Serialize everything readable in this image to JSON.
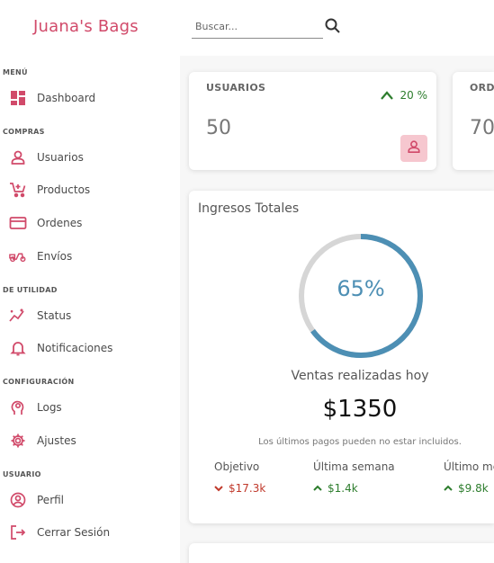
{
  "brand": {
    "name": "Juana's Bags",
    "accent": "#d14a6a"
  },
  "search": {
    "placeholder": "Buscar...",
    "icon": "search-icon"
  },
  "sidebar": {
    "sections": [
      {
        "title": "MENÚ",
        "items": [
          {
            "label": "Dashboard",
            "icon": "dashboard-icon"
          }
        ]
      },
      {
        "title": "COMPRAS",
        "items": [
          {
            "label": "Usuarios",
            "icon": "user-icon"
          },
          {
            "label": "Productos",
            "icon": "cart-icon"
          },
          {
            "label": "Ordenes",
            "icon": "credit-card-icon"
          },
          {
            "label": "Envíos",
            "icon": "delivery-scooter-icon"
          }
        ]
      },
      {
        "title": "DE UTILIDAD",
        "items": [
          {
            "label": "Status",
            "icon": "sparkle-chart-icon"
          },
          {
            "label": "Notificaciones",
            "icon": "bell-icon"
          }
        ]
      },
      {
        "title": "CONFIGURACIÓN",
        "items": [
          {
            "label": "Logs",
            "icon": "brain-head-icon"
          },
          {
            "label": "Ajustes",
            "icon": "gear-icon"
          }
        ]
      },
      {
        "title": "USUARIO",
        "items": [
          {
            "label": "Perfil",
            "icon": "profile-circle-icon"
          },
          {
            "label": "Cerrar Sesión",
            "icon": "logout-icon"
          }
        ]
      }
    ]
  },
  "stats": [
    {
      "title": "USUARIOS",
      "value": "50",
      "trend": "20 %",
      "trend_color": "#2d7d2d",
      "badge_icon": "user-icon"
    },
    {
      "title": "ORD",
      "value": "70"
    }
  ],
  "income": {
    "title": "Ingresos Totales",
    "percent": "65%",
    "progress": 0.65,
    "ring_color": "#4d8fb4",
    "track_color": "#d6d6d6",
    "sales_label": "Ventas realizadas hoy",
    "amount": "$1350",
    "note": "Los últimos pagos pueden no estar incluidos.",
    "summary": [
      {
        "label": "Objetivo",
        "value": "$17.3k",
        "direction": "down",
        "color": "#c0392b"
      },
      {
        "label": "Última semana",
        "value": "$1.4k",
        "direction": "up",
        "color": "#2d7d2d"
      },
      {
        "label": "Último mes",
        "value": "$9.8k",
        "direction": "up",
        "color": "#2d7d2d"
      }
    ]
  }
}
